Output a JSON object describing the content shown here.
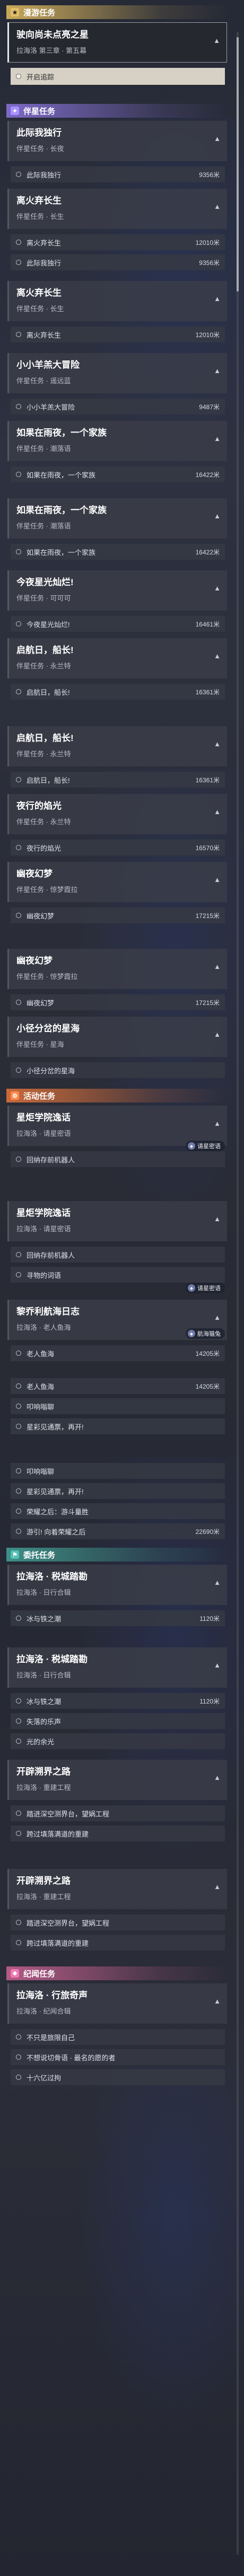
{
  "cat_main": {
    "label": "漫游任务",
    "icon": "star-icon"
  },
  "cat_partner": {
    "label": "伴星任务",
    "icon": "sparkle-icon"
  },
  "cat_event": {
    "label": "活动任务",
    "icon": "gear-icon"
  },
  "cat_daily": {
    "label": "委托任务",
    "icon": "flag-icon"
  },
  "cat_journey": {
    "label": "纪闻任务",
    "icon": "book-icon"
  },
  "mission": {
    "title": "驶向尚未点亮之星",
    "subtitle": "拉海洛 第三章 · 第五幕",
    "tracked_label": "开启追踪"
  },
  "cards": [
    {
      "title": "此际我独行",
      "subtitle": "伴星任务 · 长夜"
    },
    {
      "title": "离火弃长生",
      "subtitle": "伴星任务 · 长生"
    },
    {
      "title": "离火弃长生",
      "subtitle": "伴星任务 · 长生"
    },
    {
      "title": "小小羊羔大冒险",
      "subtitle": "伴星任务 · 遥远蓝"
    },
    {
      "title": "如果在雨夜，一个家族",
      "subtitle": "伴星任务 · 潮落语"
    },
    {
      "title": "如果在雨夜，一个家族",
      "subtitle": "伴星任务 · 潮落语"
    },
    {
      "title": "今夜星光灿烂!",
      "subtitle": "伴星任务 · 可可可"
    },
    {
      "title": "启航日，船长!",
      "subtitle": "伴星任务 · 永兰特"
    },
    {
      "title": "启航日，船长!",
      "subtitle": "伴星任务 · 永兰特"
    },
    {
      "title": "夜行的焰光",
      "subtitle": "伴星任务 · 永兰特"
    },
    {
      "title": "幽夜幻梦",
      "subtitle": "伴星任务 · 惊梦霞拉"
    },
    {
      "title": "幽夜幻梦",
      "subtitle": "伴星任务 · 惊梦霞拉"
    },
    {
      "title": "小径分岔的星海",
      "subtitle": "伴星任务 · 星海"
    },
    {
      "title": "星炬学院逸话",
      "subtitle": "拉海洛 · 请星密语"
    },
    {
      "title": "星炬学院逸话",
      "subtitle": "拉海洛 · 请星密语"
    },
    {
      "title": "黎乔利航海日志",
      "subtitle": "拉海洛 · 老人鱼海"
    },
    {
      "title": "拉海洛 · 税城踏勘",
      "subtitle": "拉海洛 · 日行合辑"
    },
    {
      "title": "拉海洛 · 税城踏勘",
      "subtitle": "拉海洛 · 日行合辑"
    },
    {
      "title": "开辟溯界之路",
      "subtitle": "拉海洛 · 重建工程"
    },
    {
      "title": "开辟溯界之路",
      "subtitle": "拉海洛 · 重建工程"
    },
    {
      "title": "拉海洛 · 行旅奇声",
      "subtitle": "拉海洛 · 纪闻合辑"
    }
  ],
  "rows": [
    {
      "name": "此际我独行",
      "dist": "9356米"
    },
    {
      "name": "离火弃长生",
      "dist": "12010米"
    },
    {
      "name": "此际我独行",
      "dist": "9356米"
    },
    {
      "name": "离火弃长生",
      "dist": "12010米"
    },
    {
      "name": "小小羊羔大冒险",
      "dist": "9487米"
    },
    {
      "name": "如果在雨夜，一个家族",
      "dist": "16422米"
    },
    {
      "name": "如果在雨夜，一个家族",
      "dist": "16422米"
    },
    {
      "name": "今夜星光灿烂!",
      "dist": "16461米"
    },
    {
      "name": "启航日，船长!",
      "dist": "16361米"
    },
    {
      "name": "启航日，船长!",
      "dist": "16361米"
    },
    {
      "name": "夜行的焰光",
      "dist": "16570米"
    },
    {
      "name": "幽夜幻梦",
      "dist": "17215米"
    },
    {
      "name": "幽夜幻梦",
      "dist": "17215米"
    },
    {
      "name": "小径分岔的星海",
      "dist": ""
    },
    {
      "name": "回纳存前机器人",
      "dist": ""
    },
    {
      "name": "回纳存前机器人",
      "dist": ""
    },
    {
      "name": "寻物的词语",
      "dist": ""
    },
    {
      "name": "老人鱼海",
      "dist": "14205米"
    },
    {
      "name": "老人鱼海",
      "dist": "14205米"
    },
    {
      "name": "叩响嗡聊",
      "dist": ""
    },
    {
      "name": "星彩见通票，再开!",
      "dist": ""
    },
    {
      "name": "叩响嗡聊",
      "dist": ""
    },
    {
      "name": "星彩见通票，再开!",
      "dist": ""
    },
    {
      "name": "荣耀之后：游斗量胜",
      "dist": ""
    },
    {
      "name": "游引! 向着荣耀之后",
      "dist": "22690米"
    },
    {
      "name": "冰与铁之潮",
      "dist": "1120米"
    },
    {
      "name": "冰与铁之潮",
      "dist": "1120米"
    },
    {
      "name": "失落的乐声",
      "dist": ""
    },
    {
      "name": "光的余光",
      "dist": ""
    },
    {
      "name": "踏进深空测界台，望娲工程",
      "dist": ""
    },
    {
      "name": "跨过填落满道的重建",
      "dist": ""
    },
    {
      "name": "踏进深空测界台，望娲工程",
      "dist": ""
    },
    {
      "name": "跨过填落满道的重建",
      "dist": ""
    },
    {
      "name": "不只是旅限自己",
      "dist": ""
    },
    {
      "name": "不想说切骨语 · 最名的愿的者",
      "dist": ""
    },
    {
      "name": "十六亿过拘",
      "dist": ""
    }
  ],
  "badges": [
    {
      "label": "请星密语"
    },
    {
      "label": "请星密语"
    },
    {
      "label": "航海猫兔"
    }
  ],
  "colors": {
    "main_accent": "#e2c06a",
    "partner_accent": "#a892ff",
    "event_accent": "#ff8a4c",
    "daily_accent": "#54c0b4",
    "journey_accent": "#f07ab4",
    "selected_row": "#d6d1c4"
  }
}
